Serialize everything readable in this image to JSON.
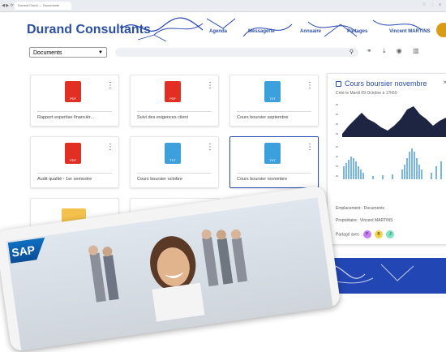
{
  "browser": {
    "tab_title": "Durand Cloud — Documents"
  },
  "header": {
    "brand": "Durand Consultants",
    "nav": [
      "Agenda",
      "Messagerie",
      "Annuaire",
      "Partages",
      "Vincent MARTINS"
    ]
  },
  "toolbar": {
    "section_select": "Documents",
    "search_placeholder": ""
  },
  "files": [
    {
      "name": "Rapport expertise financièr...",
      "type": "pdf"
    },
    {
      "name": "Suivi des exigences client",
      "type": "pdf"
    },
    {
      "name": "Cours boursier septembre",
      "type": "txt"
    },
    {
      "name": "Audit qualité - 1er semestre",
      "type": "pdf"
    },
    {
      "name": "Cours boursier octobre",
      "type": "txt"
    },
    {
      "name": "Cours boursier novembre",
      "type": "txt",
      "selected": true
    },
    {
      "name": "",
      "type": "folder"
    },
    {
      "name": "",
      "type": "folder"
    },
    {
      "name": "",
      "type": "pdf"
    }
  ],
  "file_badges": {
    "pdf": "PDF",
    "txt": "TXT"
  },
  "details": {
    "title": "Cours boursier novembre",
    "created": "Créé le Mardi 09 Octobre à 17h59",
    "location": "Emplacement : Documents",
    "owner": "Propriétaire : Vincent MARTINS",
    "shared_label": "Partagé avec :",
    "shared_with": [
      {
        "initial": "P",
        "color": "#c77ff5"
      },
      {
        "initial": "B",
        "color": "#f3d250"
      },
      {
        "initial": "J",
        "color": "#7fe0c4"
      }
    ]
  },
  "overlay": {
    "logo_text": "SAP"
  }
}
